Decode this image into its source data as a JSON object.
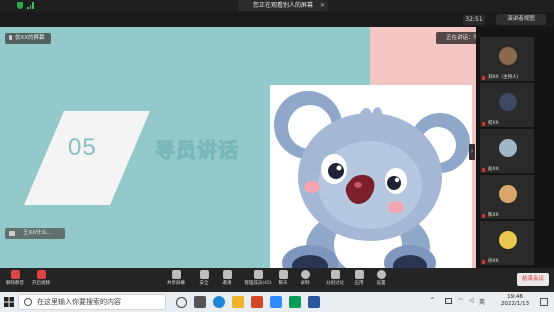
{
  "window": {
    "title_banner": "您正在观看别人的屏幕",
    "close_glyph": "✕",
    "signal_text": "ıl",
    "clock": "32:51",
    "gallery_view_label": "演讲者视图"
  },
  "stage": {
    "slide_number": "05",
    "slide_heading": "导员讲话",
    "speaker_tag": "张XX的屏幕",
    "speaking_indicator": "正在讲话：李XX",
    "local_name_tag": "王XX什么...",
    "colors": {
      "teal": "#93c9ca",
      "pink": "#f3c6c4"
    }
  },
  "sidebar": {
    "participants": [
      {
        "name": "刘XX（主持人）",
        "muted": true
      },
      {
        "name": "何XX",
        "muted": true
      },
      {
        "name": "赵XX",
        "muted": true
      },
      {
        "name": "陈XX",
        "muted": true
      },
      {
        "name": "孙XX",
        "muted": true
      }
    ]
  },
  "toolbar": {
    "items": [
      {
        "label": "解除静音",
        "icon": "microphone-icon"
      },
      {
        "label": "开启视频",
        "icon": "camera-icon"
      },
      {
        "label": "共享屏幕",
        "icon": "share-screen-icon"
      },
      {
        "label": "安全",
        "icon": "shield-icon"
      },
      {
        "label": "邀请",
        "icon": "invite-icon"
      },
      {
        "label": "管理成员(45)",
        "icon": "participants-icon"
      },
      {
        "label": "聊天",
        "icon": "chat-icon"
      },
      {
        "label": "录制",
        "icon": "record-icon"
      },
      {
        "label": "分组讨论",
        "icon": "breakout-icon"
      },
      {
        "label": "应用",
        "icon": "apps-icon"
      },
      {
        "label": "设置",
        "icon": "settings-icon"
      }
    ],
    "end_meeting": "结束会议"
  },
  "taskbar": {
    "search_placeholder": "在这里输入你要搜索的内容",
    "tray_text": "英",
    "time": "19:46",
    "date": "2022/1/13"
  }
}
